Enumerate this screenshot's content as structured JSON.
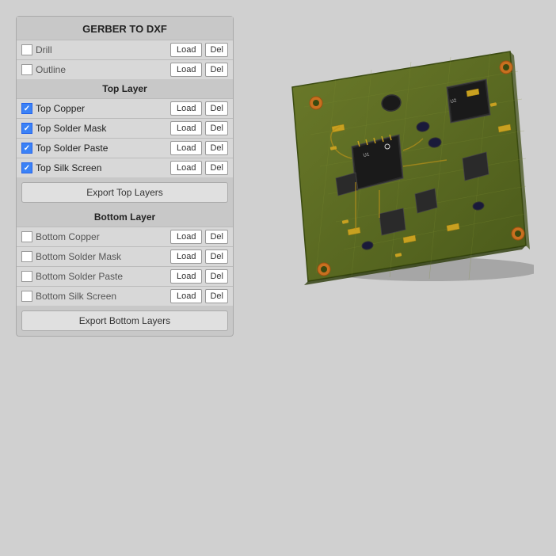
{
  "panel": {
    "title": "GERBER TO DXF",
    "drill_label": "Drill",
    "outline_label": "Outline",
    "top_layer_header": "Top Layer",
    "bottom_layer_header": "Bottom Layer",
    "top_rows": [
      {
        "label": "Top Copper",
        "checked": true
      },
      {
        "label": "Top Solder Mask",
        "checked": true
      },
      {
        "label": "Top Solder Paste",
        "checked": true
      },
      {
        "label": "Top Silk Screen",
        "checked": true
      }
    ],
    "bottom_rows": [
      {
        "label": "Bottom Copper",
        "checked": false
      },
      {
        "label": "Bottom Solder Mask",
        "checked": false
      },
      {
        "label": "Bottom Solder Paste",
        "checked": false
      },
      {
        "label": "Bottom Silk Screen",
        "checked": false
      }
    ],
    "export_top_label": "Export Top Layers",
    "export_bottom_label": "Export Bottom Layers",
    "load_label": "Load",
    "del_label": "Del"
  }
}
